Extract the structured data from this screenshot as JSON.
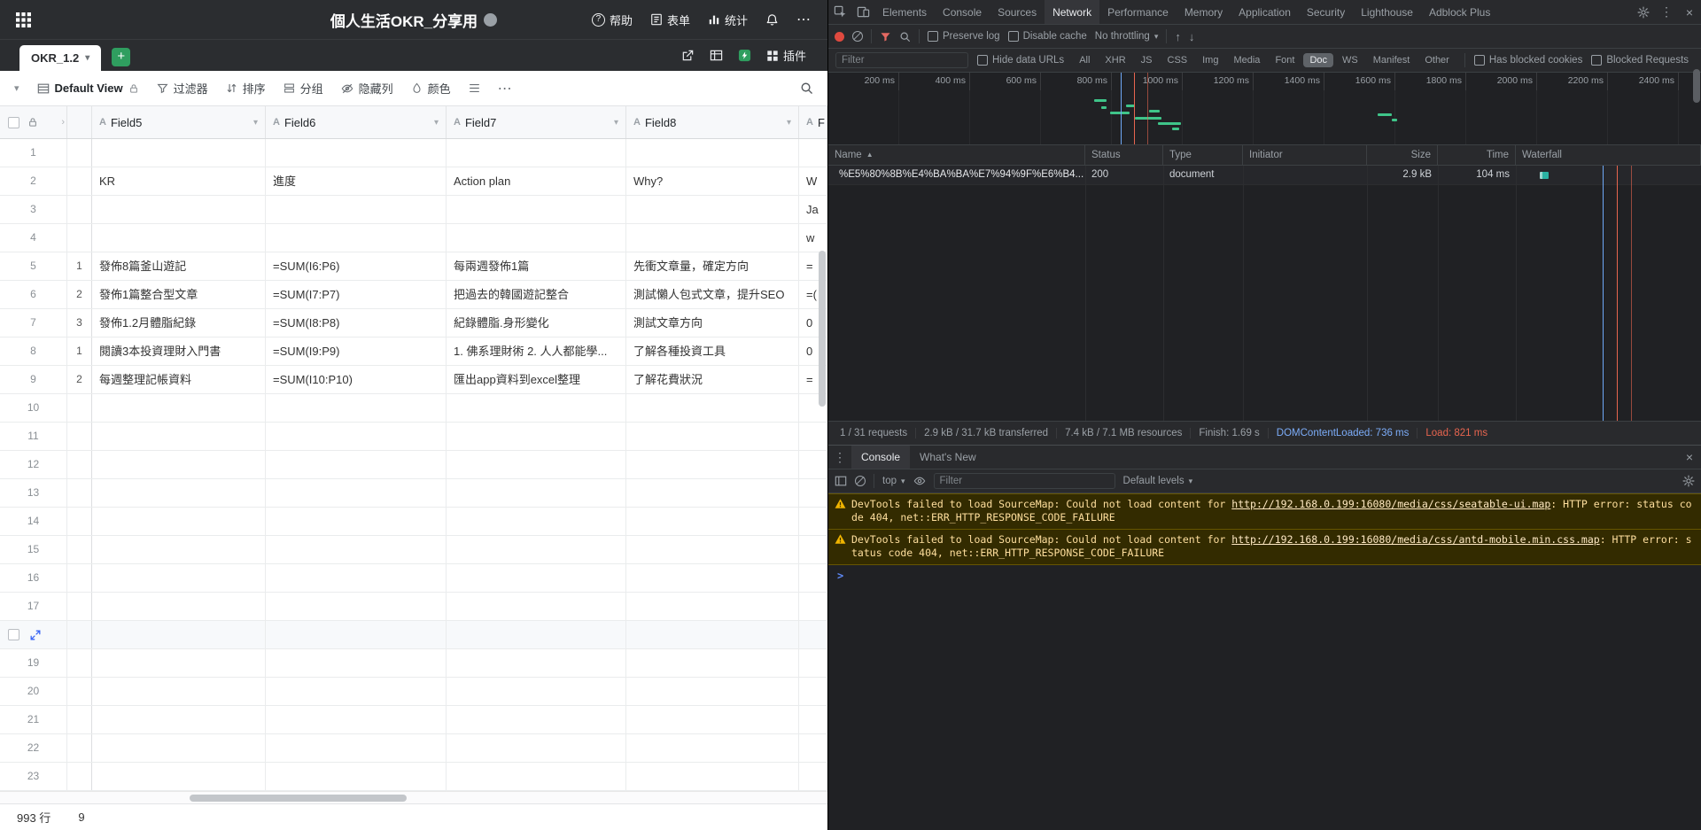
{
  "app": {
    "header": {
      "title": "個人生活OKR_分享用",
      "help": "帮助",
      "forms": "表单",
      "stats": "统计"
    },
    "tabbar": {
      "active_tab": "OKR_1.2",
      "plugins": "插件"
    },
    "toolbar": {
      "view_name": "Default View",
      "filter": "过滤器",
      "sort": "排序",
      "group": "分组",
      "hide_columns": "隐藏列",
      "color": "颜色"
    },
    "grid": {
      "columns": [
        "Field5",
        "Field6",
        "Field7",
        "Field8",
        "F"
      ],
      "rows": [
        {
          "num": "1",
          "sub": "",
          "f5": "",
          "f6": "",
          "f7": "",
          "f8": "",
          "f9": ""
        },
        {
          "num": "2",
          "sub": "",
          "f5": "KR",
          "f6": "進度",
          "f7": "Action plan",
          "f8": "Why?",
          "f9": "W"
        },
        {
          "num": "3",
          "sub": "",
          "f5": "",
          "f6": "",
          "f7": "",
          "f8": "",
          "f9": "Ja"
        },
        {
          "num": "4",
          "sub": "",
          "f5": "",
          "f6": "",
          "f7": "",
          "f8": "",
          "f9": "w"
        },
        {
          "num": "5",
          "sub": "1",
          "f5": "發佈8篇釜山遊記",
          "f6": "=SUM(I6:P6)",
          "f7": "每兩週發佈1篇",
          "f8": "先衝文章量，確定方向",
          "f9": "="
        },
        {
          "num": "6",
          "sub": "2",
          "f5": "發佈1篇整合型文章",
          "f6": "=SUM(I7:P7)",
          "f7": "把過去的韓國遊記整合",
          "f8": "測試懶人包式文章，提升SEO",
          "f9": "=("
        },
        {
          "num": "7",
          "sub": "3",
          "f5": "發佈1.2月體脂紀錄",
          "f6": "=SUM(I8:P8)",
          "f7": "紀錄體脂.身形變化",
          "f8": "測試文章方向",
          "f9": "0"
        },
        {
          "num": "8",
          "sub": "1",
          "f5": "閱讀3本投資理財入門書",
          "f6": "=SUM(I9:P9)",
          "f7": "1. 佛系理財術 2. 人人都能學...",
          "f8": "了解各種投資工具",
          "f9": "0"
        },
        {
          "num": "9",
          "sub": "2",
          "f5": "每週整理記帳資料",
          "f6": "=SUM(I10:P10)",
          "f7": "匯出app資料到excel整理",
          "f8": "了解花費狀況",
          "f9": "="
        },
        {
          "num": "10",
          "sub": "",
          "f5": "",
          "f6": "",
          "f7": "",
          "f8": "",
          "f9": ""
        },
        {
          "num": "11",
          "sub": "",
          "f5": "",
          "f6": "",
          "f7": "",
          "f8": "",
          "f9": ""
        },
        {
          "num": "12",
          "sub": "",
          "f5": "",
          "f6": "",
          "f7": "",
          "f8": "",
          "f9": ""
        },
        {
          "num": "13",
          "sub": "",
          "f5": "",
          "f6": "",
          "f7": "",
          "f8": "",
          "f9": ""
        },
        {
          "num": "14",
          "sub": "",
          "f5": "",
          "f6": "",
          "f7": "",
          "f8": "",
          "f9": ""
        },
        {
          "num": "15",
          "sub": "",
          "f5": "",
          "f6": "",
          "f7": "",
          "f8": "",
          "f9": ""
        },
        {
          "num": "16",
          "sub": "",
          "f5": "",
          "f6": "",
          "f7": "",
          "f8": "",
          "f9": ""
        },
        {
          "num": "17",
          "sub": "",
          "f5": "",
          "f6": "",
          "f7": "",
          "f8": "",
          "f9": ""
        },
        {
          "num": "",
          "hover": true,
          "sub": "",
          "f5": "",
          "f6": "",
          "f7": "",
          "f8": "",
          "f9": ""
        },
        {
          "num": "19",
          "sub": "",
          "f5": "",
          "f6": "",
          "f7": "",
          "f8": "",
          "f9": ""
        },
        {
          "num": "20",
          "sub": "",
          "f5": "",
          "f6": "",
          "f7": "",
          "f8": "",
          "f9": ""
        },
        {
          "num": "21",
          "sub": "",
          "f5": "",
          "f6": "",
          "f7": "",
          "f8": "",
          "f9": ""
        },
        {
          "num": "22",
          "sub": "",
          "f5": "",
          "f6": "",
          "f7": "",
          "f8": "",
          "f9": ""
        },
        {
          "num": "23",
          "sub": "",
          "f5": "",
          "f6": "",
          "f7": "",
          "f8": "",
          "f9": ""
        }
      ]
    },
    "status_bar": {
      "row_count": "993 行",
      "stat": "9"
    }
  },
  "devtools": {
    "tabs": [
      "Elements",
      "Console",
      "Sources",
      "Network",
      "Performance",
      "Memory",
      "Application",
      "Security",
      "Lighthouse",
      "Adblock Plus"
    ],
    "active_tab": "Network",
    "network": {
      "toolbar": {
        "preserve_log": "Preserve log",
        "disable_cache": "Disable cache",
        "throttling": "No throttling"
      },
      "filter_placeholder": "Filter",
      "hide_data_urls": "Hide data URLs",
      "filters": [
        "All",
        "XHR",
        "JS",
        "CSS",
        "Img",
        "Media",
        "Font",
        "Doc",
        "WS",
        "Manifest",
        "Other"
      ],
      "active_filter": "Doc",
      "has_blocked_cookies": "Has blocked cookies",
      "blocked_requests": "Blocked Requests",
      "timeline_labels": [
        "200 ms",
        "400 ms",
        "600 ms",
        "800 ms",
        "1000 ms",
        "1200 ms",
        "1400 ms",
        "1600 ms",
        "1800 ms",
        "2000 ms",
        "2200 ms",
        "2400 ms"
      ],
      "columns": [
        "Name",
        "Status",
        "Type",
        "Initiator",
        "Size",
        "Time",
        "Waterfall"
      ],
      "requests": [
        {
          "name": "%E5%80%8B%E4%BA%BA%E7%94%9F%E6%B4...",
          "status": "200",
          "type": "document",
          "initiator": "",
          "size": "2.9 kB",
          "time": "104 ms"
        }
      ],
      "summary": [
        "1 / 31 requests",
        "2.9 kB / 31.7 kB transferred",
        "7.4 kB / 7.1 MB resources",
        "Finish: 1.69 s",
        "DOMContentLoaded: 736 ms",
        "Load: 821 ms"
      ]
    },
    "console": {
      "tabs": [
        "Console",
        "What's New"
      ],
      "active_tab": "Console",
      "context": "top",
      "filter_placeholder": "Filter",
      "levels": "Default levels",
      "messages": [
        {
          "prefix": "DevTools failed to load SourceMap: Could not load content for ",
          "link": "http://192.168.0.199:16080/media/css/seatable-ui.map",
          "suffix": ": HTTP error: status code 404, net::ERR_HTTP_RESPONSE_CODE_FAILURE"
        },
        {
          "prefix": "DevTools failed to load SourceMap: Could not load content for ",
          "link": "http://192.168.0.199:16080/media/css/antd-mobile.min.css.map",
          "suffix": ": HTTP error: status code 404, net::ERR_HTTP_RESPONSE_CODE_FAILURE"
        }
      ]
    }
  },
  "colors": {
    "accent_green": "#2f9e5f",
    "devtools_blue": "#7cacf8",
    "devtools_red": "#e8654f",
    "warning_bg": "#332b00",
    "warning_text": "#ffdf9e"
  }
}
